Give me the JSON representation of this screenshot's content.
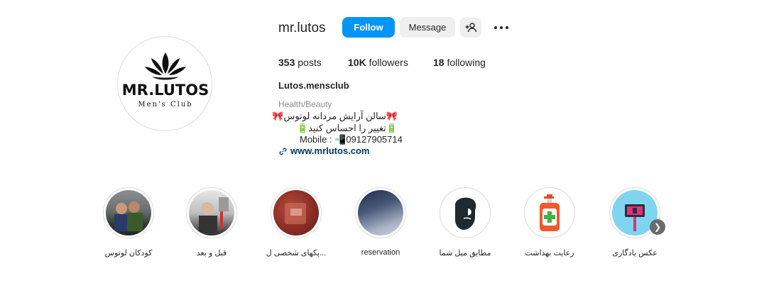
{
  "profile": {
    "username": "mr.lutos",
    "logo_text": "MR.LUTOS",
    "logo_subtext": "Men's Club",
    "buttons": {
      "follow": "Follow",
      "message": "Message",
      "suggest_icon": "person-add-icon",
      "more_icon": "more-options-icon"
    },
    "stats": [
      {
        "count": "353",
        "label": "posts"
      },
      {
        "count": "10K",
        "label": "followers"
      },
      {
        "count": "18",
        "label": "following"
      }
    ],
    "bio": {
      "name": "Lutos.mensclub",
      "category": "Health/Beauty",
      "lines": [
        "🎀سالن آرایش مردانه لوتوس🎀",
        "🔋تغییر را احساس کنید🔋",
        "Mobile : 📲09127905714"
      ],
      "link_icon": "link-icon",
      "link": "www.mrlutos.com"
    }
  },
  "highlights": [
    {
      "label": "کودکان لوتوس"
    },
    {
      "label": "قبل و بعد"
    },
    {
      "label": "پکهای شخصی ل..."
    },
    {
      "label": "reservation"
    },
    {
      "label": "مطابق میل شما"
    },
    {
      "label": "رعایت بهداشت"
    },
    {
      "label": "عکس یادگاری"
    }
  ],
  "carousel": {
    "next_icon": "chevron-right-icon"
  },
  "colors": {
    "primary_button": "#0095f6",
    "secondary_button": "#efefef",
    "link": "#00376b",
    "muted": "#8e8e8e"
  }
}
